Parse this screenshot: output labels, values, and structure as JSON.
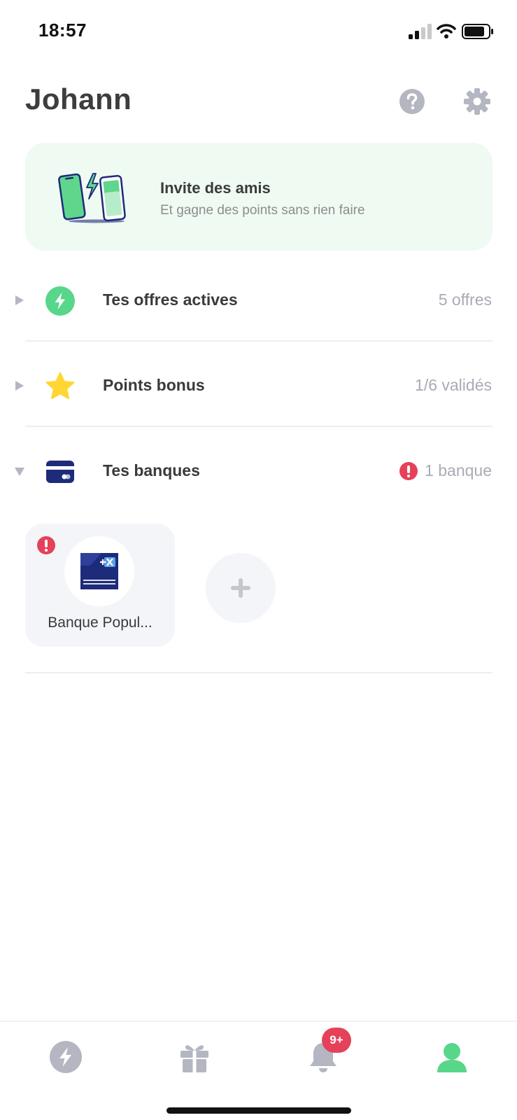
{
  "status_bar": {
    "time": "18:57"
  },
  "header": {
    "title": "Johann"
  },
  "invite_card": {
    "title": "Invite des amis",
    "subtitle": "Et gagne des points sans rien faire"
  },
  "sections": {
    "offers": {
      "label": "Tes offres actives",
      "meta": "5 offres",
      "icon": "lightning-icon"
    },
    "bonus": {
      "label": "Points bonus",
      "meta": "1/6 validés",
      "icon": "star-icon"
    },
    "banks": {
      "label": "Tes banques",
      "meta": "1 banque",
      "icon": "bank-card-icon"
    }
  },
  "banks": [
    {
      "name": "Banque Popul..."
    }
  ],
  "bottom_nav": {
    "items": [
      "lightning-icon",
      "gift-icon",
      "bell-icon",
      "profile-icon"
    ],
    "notifications_badge": "9+",
    "active": "profile-icon"
  },
  "colors": {
    "accent_green": "#58d68a",
    "alert_red": "#e5415a",
    "navy": "#1e2a7a",
    "muted_icon": "#b4b6c1",
    "star_yellow": "#ffd633"
  }
}
